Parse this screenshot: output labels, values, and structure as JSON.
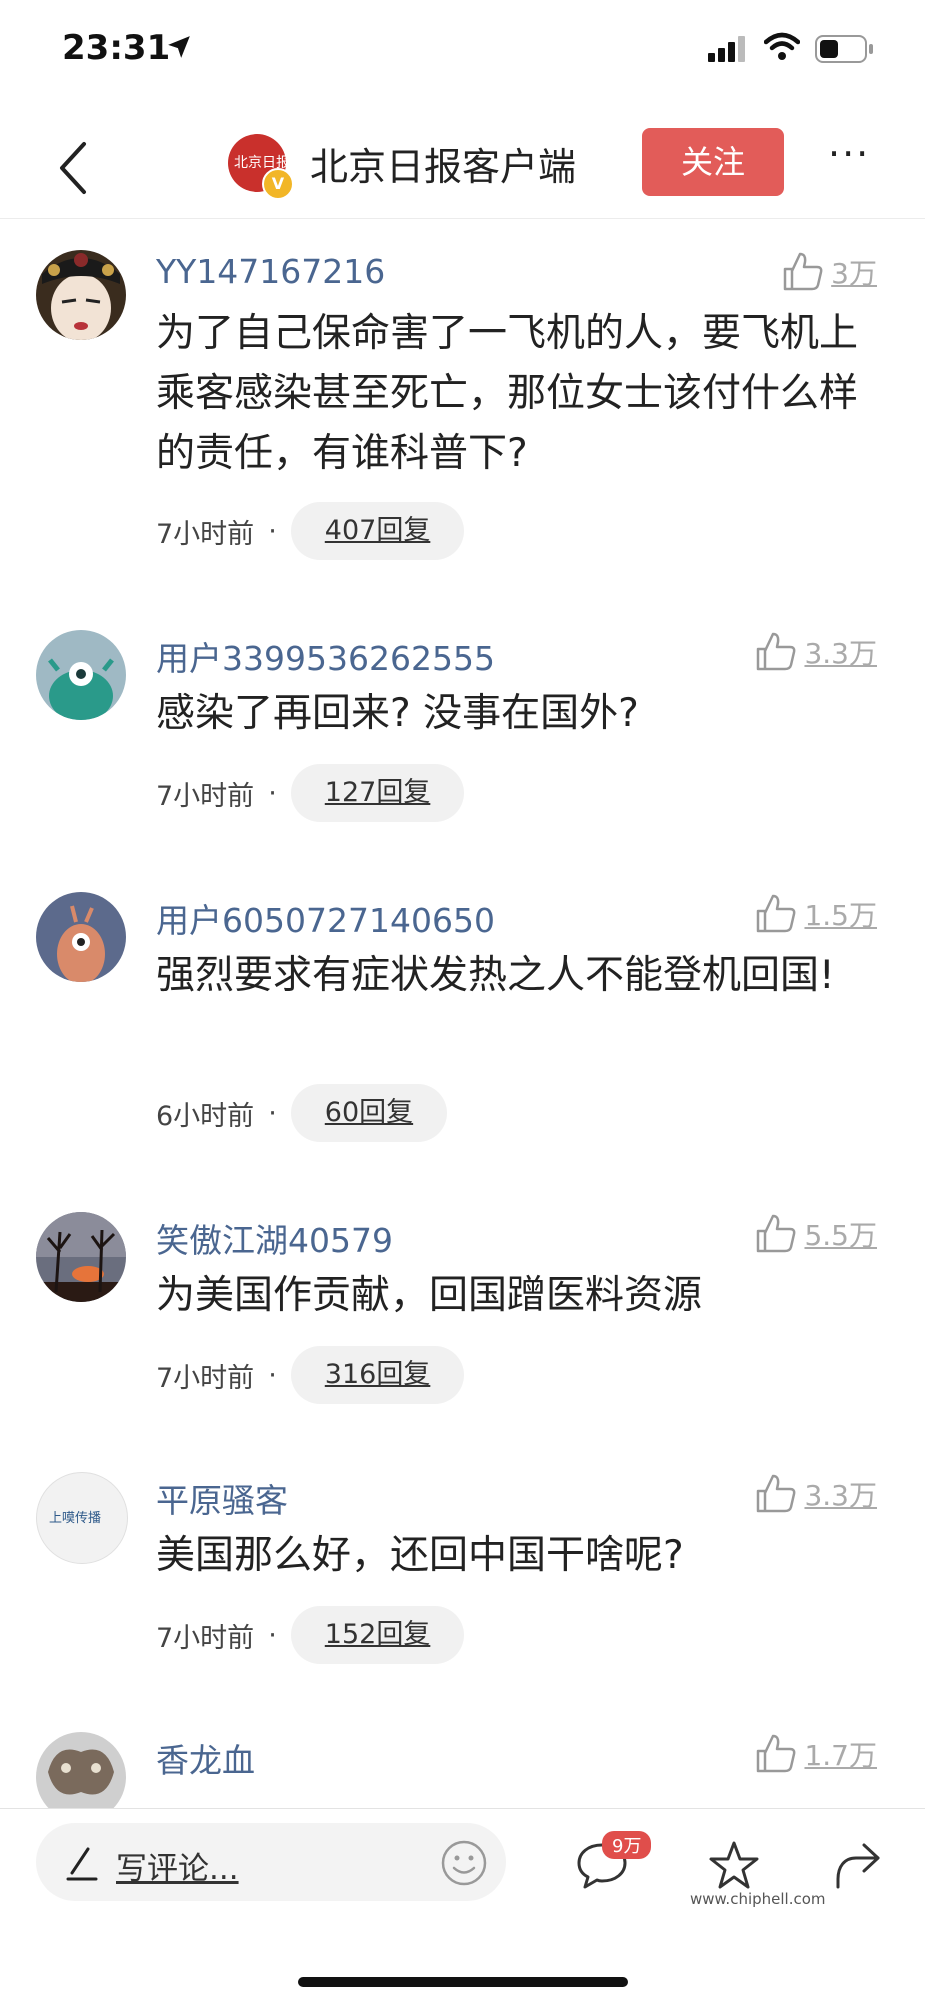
{
  "status_bar": {
    "time": "23:31"
  },
  "nav": {
    "title": "北京日报客户端",
    "follow_label": "关注",
    "more_label": "···",
    "logo_text": "北京日报",
    "verified_mark": "V"
  },
  "comments": [
    {
      "user": "YY147167216",
      "text": "为了自己保命害了一飞机的人，要飞机上乘客感染甚至死亡，那位女士该付什么样的责任，有谁科普下?",
      "time": "7小时前",
      "replies": "407回复",
      "likes": "3万"
    },
    {
      "user": "用户3399536262555",
      "text": "感染了再回来? 没事在国外?",
      "time": "7小时前",
      "replies": "127回复",
      "likes": "3.3万"
    },
    {
      "user": "用户6050727140650",
      "text": "强烈要求有症状发热之人不能登机回国!",
      "time": "6小时前",
      "replies": "60回复",
      "likes": "1.5万"
    },
    {
      "user": "笑傲江湖40579",
      "text": "为美国作贡献，回国蹭医料资源",
      "time": "7小时前",
      "replies": "316回复",
      "likes": "5.5万"
    },
    {
      "user": "平原骚客",
      "text": "美国那么好，还回中国干啥呢?",
      "time": "7小时前",
      "replies": "152回复",
      "likes": "3.3万",
      "avatar_text": "上嗼传播"
    },
    {
      "user": "香龙血",
      "likes": "1.7万"
    }
  ],
  "bottom_bar": {
    "input_placeholder": "写评论...",
    "comment_count_badge": "9万"
  },
  "watermark": "www.chiphell.com",
  "colors": {
    "accent": "#e25c59",
    "username": "#4a6690",
    "badge": "#e04e4b"
  }
}
